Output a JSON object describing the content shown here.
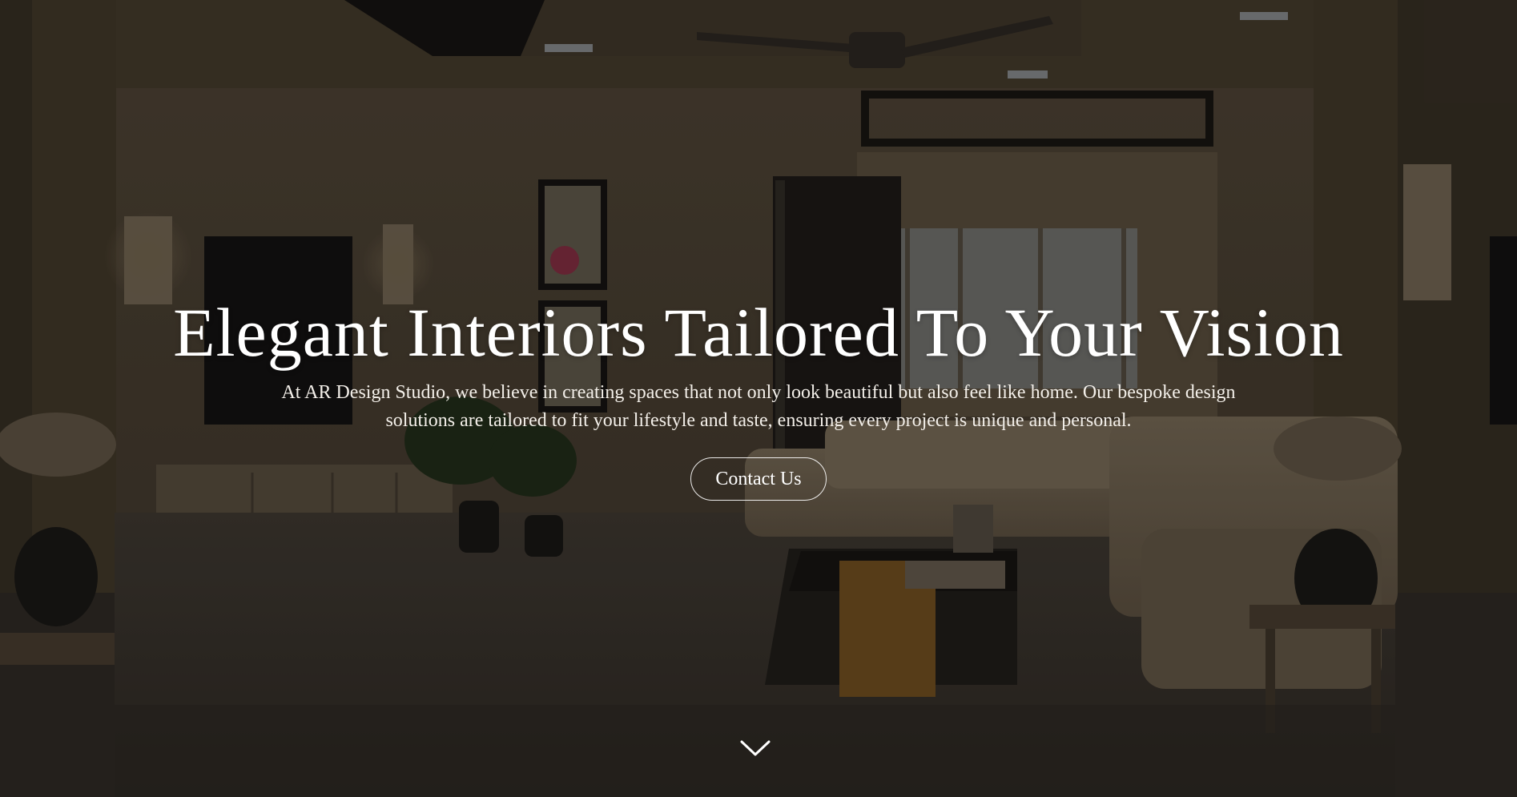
{
  "hero": {
    "title": "Elegant Interiors Tailored To Your Vision",
    "subtitle": "At AR Design Studio, we believe in creating spaces that not only look beautiful but also feel like home. Our bespoke design solutions are tailored to fit your lifestyle and taste, ensuring every project is unique and personal.",
    "cta_label": "Contact Us",
    "scroll_icon": "chevron-down-icon",
    "background_image": "living-room-interior"
  },
  "colors": {
    "text": "#ffffff",
    "overlay": "#000000"
  }
}
